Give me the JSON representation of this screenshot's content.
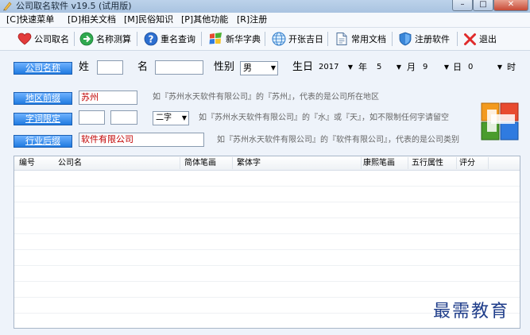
{
  "window": {
    "title": "公司取名软件 v19.5 (试用版)",
    "controls": {
      "minimize": "–",
      "maximize": "□",
      "close": "✕"
    }
  },
  "menu": [
    {
      "label": "[C]快速菜单"
    },
    {
      "label": "[D]相关文档"
    },
    {
      "label": "[M]民俗知识"
    },
    {
      "label": "[P]其他功能"
    },
    {
      "label": "[R]注册"
    }
  ],
  "toolbar": [
    {
      "label": "公司取名",
      "icon": "heart-icon"
    },
    {
      "label": "名称测算",
      "icon": "arrow-right-icon"
    },
    {
      "label": "重名查询",
      "icon": "help-icon"
    },
    {
      "label": "新华字典",
      "icon": "windows-icon"
    },
    {
      "label": "开张吉日",
      "icon": "network-icon"
    },
    {
      "label": "常用文档",
      "icon": "document-icon"
    },
    {
      "label": "注册软件",
      "icon": "shield-icon"
    },
    {
      "label": "退出",
      "icon": "close-icon"
    }
  ],
  "form": {
    "company_name_button": "公司名称",
    "surname_label": "姓",
    "surname_value": "",
    "given_name_label": "名",
    "given_name_value": "",
    "gender_label": "性别",
    "gender_value": "男",
    "birthday_label": "生日",
    "year_value": "2017",
    "year_unit": "年",
    "month_value": "5",
    "month_unit": "月",
    "day_value": "9",
    "day_unit": "日",
    "hour_value": "0",
    "hour_unit": "时",
    "region_button": "地区前缀",
    "region_value": "苏州",
    "region_hint": "如『苏州水天软件有限公司』的『苏州』，代表的是公司所在地区",
    "char_limit_button": "字词限定",
    "char_limit_1": "",
    "char_limit_2": "",
    "char_count_value": "二字",
    "char_limit_hint": "如『苏州水天软件有限公司』的『水』或『天』，如不限制任何字请留空",
    "industry_button": "行业后缀",
    "industry_value": "软件有限公司",
    "industry_hint": "如『苏州水天软件有限公司』的『软件有限公司』，代表的是公司类别"
  },
  "table": {
    "columns": [
      "编号",
      "公司名",
      "简体笔画",
      "繁体字",
      "康熙笔画",
      "五行属性",
      "评分"
    ],
    "rows": []
  },
  "watermark": "最需教育",
  "colors": {
    "blue_button": "#1f7ae0",
    "red_text": "#c00000",
    "watermark": "#1f3d8a"
  }
}
